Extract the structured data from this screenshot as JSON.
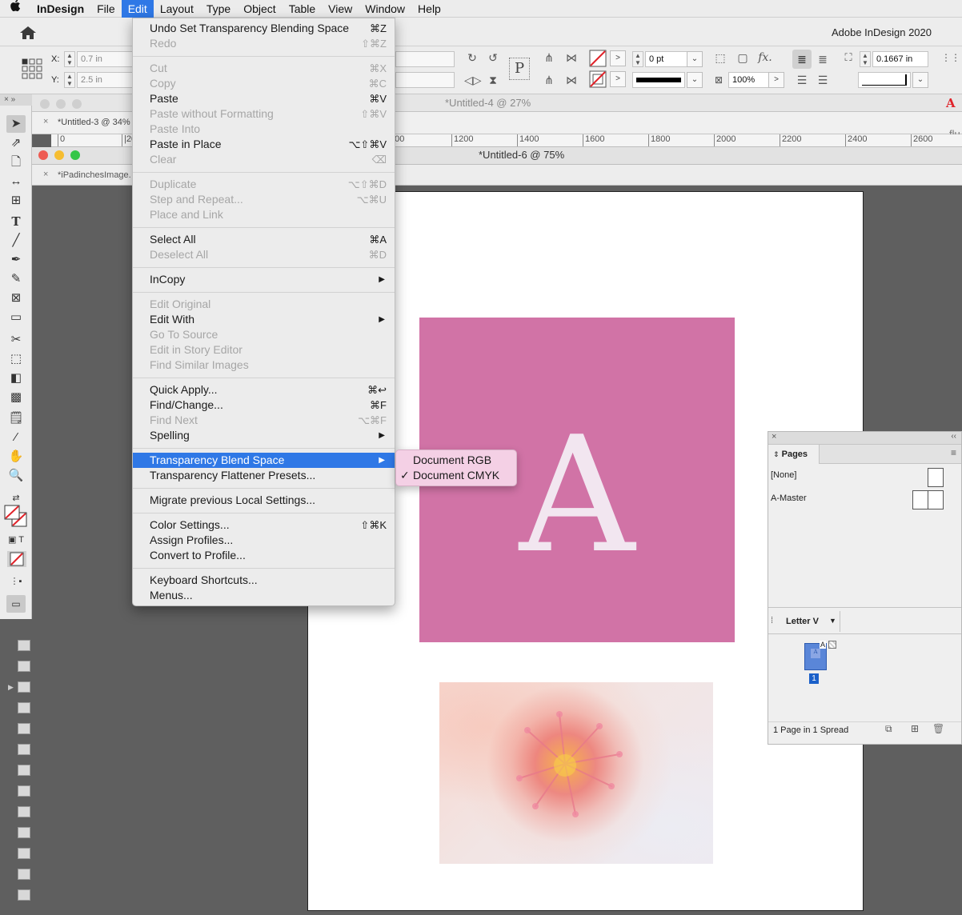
{
  "menubar": {
    "app": "InDesign",
    "items": [
      "File",
      "Edit",
      "Layout",
      "Type",
      "Object",
      "Table",
      "View",
      "Window",
      "Help"
    ]
  },
  "appbar": {
    "app_name": "Adobe InDesign 2020"
  },
  "control": {
    "x_label": "X:",
    "x_value": "0.7 in",
    "y_label": "Y:",
    "y_value": "2.5 in",
    "stroke_weight": "0 pt",
    "scale": "100%",
    "offset": "0.1667 in",
    "fx": "fx."
  },
  "tabs": {
    "untitled4": "*Untitled-4 @ 27%",
    "untitled3": "*Untitled-3 @ 34%",
    "untitled6": "*Untitled-6 @ 75%",
    "ipad": "*iPadinchesImage.",
    "right_fragment": "flu"
  },
  "ruler": {
    "ticks": [
      "0",
      "|20",
      "000",
      "1200",
      "1400",
      "1600",
      "1800",
      "2000",
      "2200",
      "2400",
      "2600"
    ]
  },
  "document": {
    "letter": "A"
  },
  "edit_menu": {
    "items": [
      {
        "label": "Undo Set Transparency Blending Space",
        "shortcut": "⌘Z",
        "disabled": false
      },
      {
        "label": "Redo",
        "shortcut": "⇧⌘Z",
        "disabled": true
      },
      {
        "label": "Cut",
        "shortcut": "⌘X",
        "disabled": true
      },
      {
        "label": "Copy",
        "shortcut": "⌘C",
        "disabled": true
      },
      {
        "label": "Paste",
        "shortcut": "⌘V",
        "disabled": false
      },
      {
        "label": "Paste without Formatting",
        "shortcut": "⇧⌘V",
        "disabled": true
      },
      {
        "label": "Paste Into",
        "shortcut": "",
        "disabled": true
      },
      {
        "label": "Paste in Place",
        "shortcut": "⌥⇧⌘V",
        "disabled": false
      },
      {
        "label": "Clear",
        "shortcut": "⌫",
        "disabled": true
      },
      {
        "label": "Duplicate",
        "shortcut": "⌥⇧⌘D",
        "disabled": true
      },
      {
        "label": "Step and Repeat...",
        "shortcut": "⌥⌘U",
        "disabled": true
      },
      {
        "label": "Place and Link",
        "shortcut": "",
        "disabled": true
      },
      {
        "label": "Select All",
        "shortcut": "⌘A",
        "disabled": false
      },
      {
        "label": "Deselect All",
        "shortcut": "⌘D",
        "disabled": true
      },
      {
        "label": "InCopy",
        "shortcut": "",
        "disabled": false
      },
      {
        "label": "Edit Original",
        "shortcut": "",
        "disabled": true
      },
      {
        "label": "Edit With",
        "shortcut": "",
        "disabled": false
      },
      {
        "label": "Go To Source",
        "shortcut": "",
        "disabled": true
      },
      {
        "label": "Edit in Story Editor",
        "shortcut": "",
        "disabled": true
      },
      {
        "label": "Find Similar Images",
        "shortcut": "",
        "disabled": true
      },
      {
        "label": "Quick Apply...",
        "shortcut": "⌘↩",
        "disabled": false
      },
      {
        "label": "Find/Change...",
        "shortcut": "⌘F",
        "disabled": false
      },
      {
        "label": "Find Next",
        "shortcut": "⌥⌘F",
        "disabled": true
      },
      {
        "label": "Spelling",
        "shortcut": "",
        "disabled": false
      },
      {
        "label": "Transparency Blend Space",
        "shortcut": "",
        "disabled": false
      },
      {
        "label": "Transparency Flattener Presets...",
        "shortcut": "",
        "disabled": false
      },
      {
        "label": "Migrate previous Local Settings...",
        "shortcut": "",
        "disabled": false
      },
      {
        "label": "Color Settings...",
        "shortcut": "⇧⌘K",
        "disabled": false
      },
      {
        "label": "Assign Profiles...",
        "shortcut": "",
        "disabled": false
      },
      {
        "label": "Convert to Profile...",
        "shortcut": "",
        "disabled": false
      },
      {
        "label": "Keyboard Shortcuts...",
        "shortcut": "",
        "disabled": false
      },
      {
        "label": "Menus...",
        "shortcut": "",
        "disabled": false
      }
    ],
    "submenu_arrow": "▶"
  },
  "submenu": {
    "items": [
      {
        "label": "Document RGB",
        "checked": false
      },
      {
        "label": "Document CMYK",
        "checked": true
      }
    ],
    "check": "✓"
  },
  "pages_panel": {
    "title": "Pages",
    "none_label": "[None]",
    "master_label": "A-Master",
    "size_label": "Letter V",
    "page_number": "1",
    "master_prefix": "A",
    "status": "1 Page in 1 Spread"
  },
  "colors": {
    "accent": "#2f78e6",
    "pink_box": "#d173a6",
    "submenu_bg": "#f4d0e5"
  },
  "icons": [
    "apple-icon",
    "home-icon",
    "selection-tool-icon",
    "direct-selection-tool-icon",
    "page-tool-icon",
    "gap-tool-icon",
    "content-collector-icon",
    "type-tool-icon",
    "line-tool-icon",
    "pen-tool-icon",
    "pencil-tool-icon",
    "rectangle-frame-tool-icon",
    "rectangle-tool-icon",
    "scissors-tool-icon",
    "free-transform-tool-icon",
    "gradient-swatch-tool-icon",
    "gradient-feather-tool-icon",
    "note-tool-icon",
    "eyedropper-tool-icon",
    "hand-tool-icon",
    "zoom-tool-icon"
  ]
}
